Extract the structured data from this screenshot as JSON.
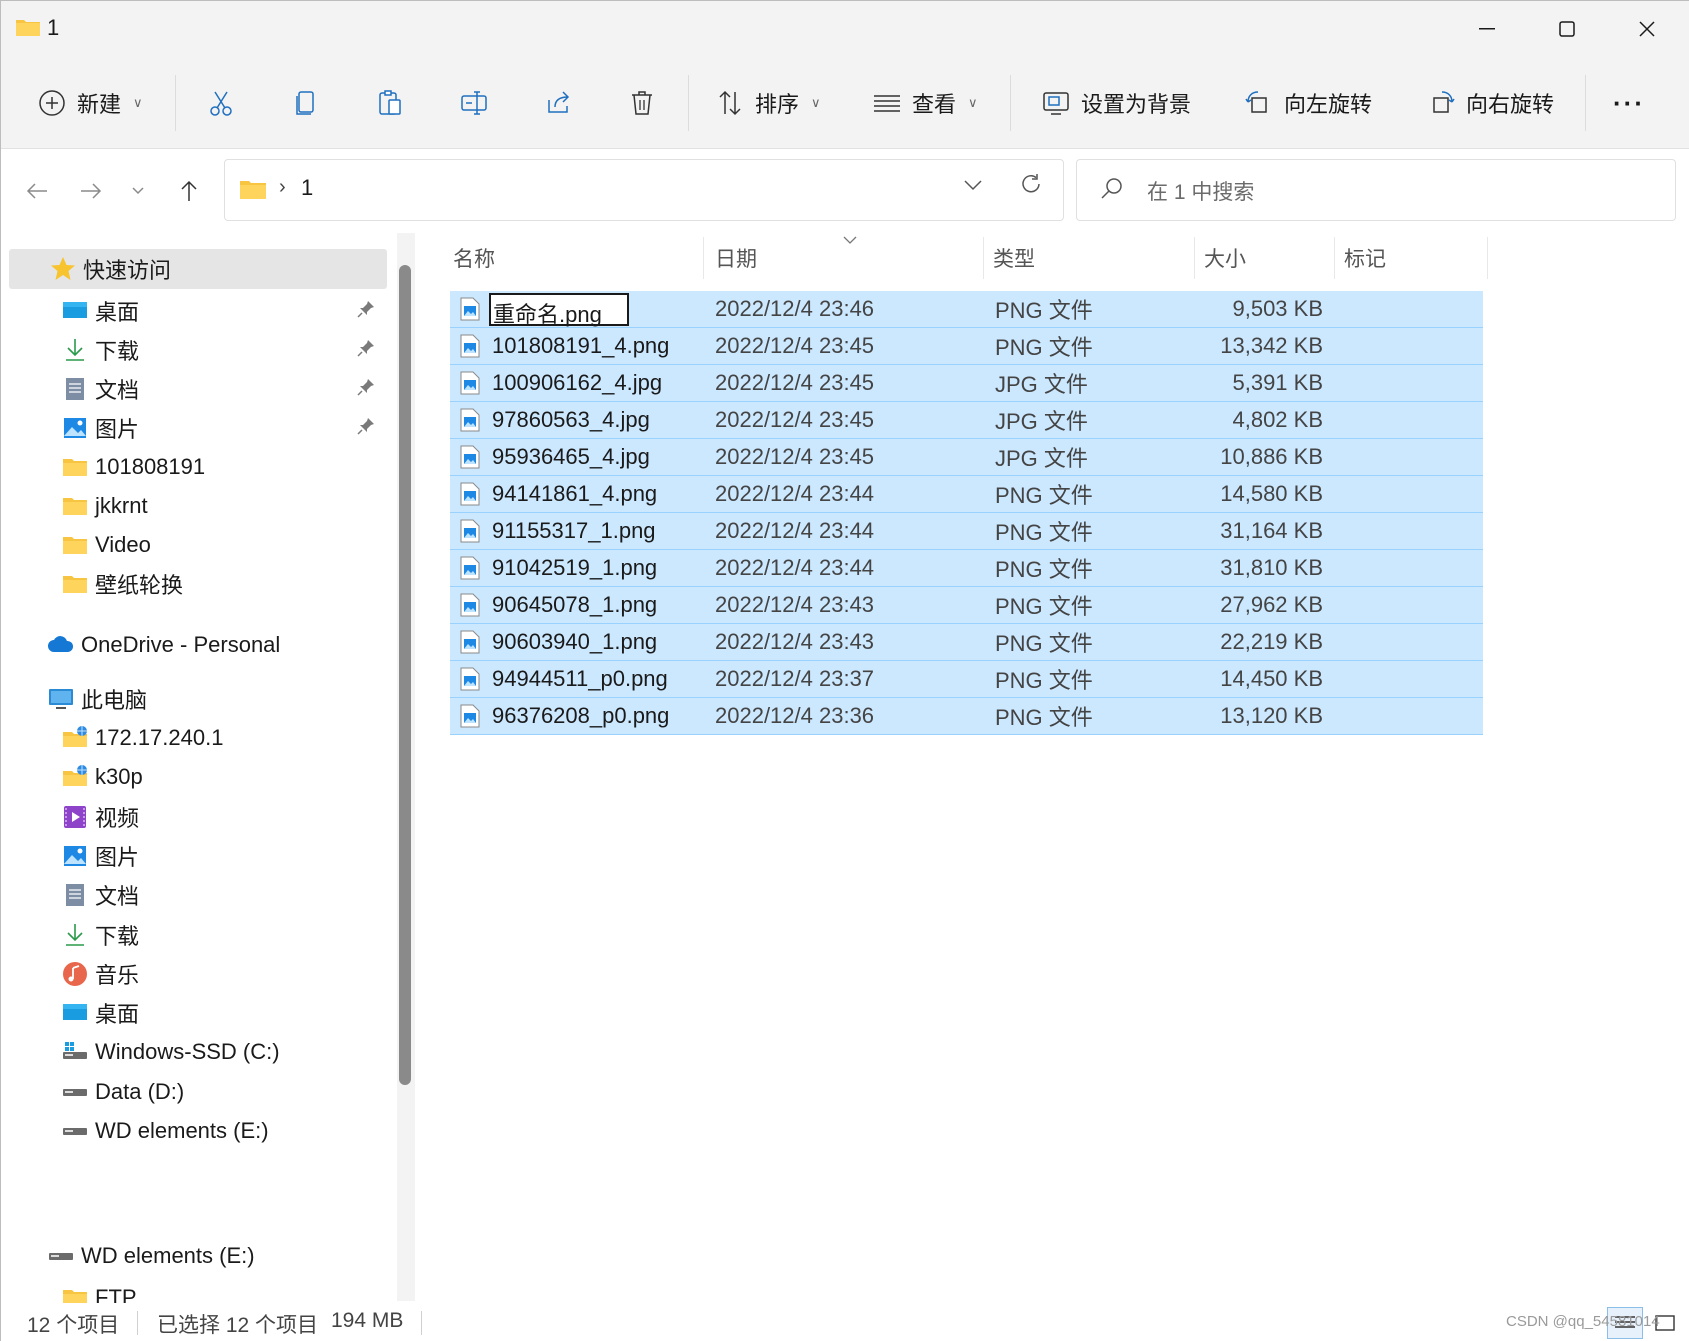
{
  "window": {
    "title": "1"
  },
  "toolbar": {
    "new_label": "新建",
    "sort_label": "排序",
    "view_label": "查看",
    "set_bg_label": "设置为背景",
    "rotate_left_label": "向左旋转",
    "rotate_right_label": "向右旋转",
    "more_label": "···"
  },
  "address": {
    "path": "1",
    "separator": "›"
  },
  "search": {
    "placeholder": "在 1 中搜索"
  },
  "sidebar": {
    "quick_access": "快速访问",
    "items": [
      {
        "label": "桌面",
        "icon": "desktop-icon",
        "pinned": true
      },
      {
        "label": "下载",
        "icon": "download-icon",
        "pinned": true
      },
      {
        "label": "文档",
        "icon": "document-icon",
        "pinned": true
      },
      {
        "label": "图片",
        "icon": "pictures-icon",
        "pinned": true
      },
      {
        "label": "101808191",
        "icon": "folder-icon",
        "pinned": false
      },
      {
        "label": "jkkrnt",
        "icon": "folder-icon",
        "pinned": false
      },
      {
        "label": "Video",
        "icon": "folder-icon",
        "pinned": false
      },
      {
        "label": "壁纸轮换",
        "icon": "folder-icon",
        "pinned": false
      }
    ],
    "onedrive": "OneDrive - Personal",
    "this_pc": "此电脑",
    "pc_items": [
      {
        "label": "172.17.240.1",
        "icon": "network-drive-icon"
      },
      {
        "label": "k30p",
        "icon": "network-drive-icon"
      },
      {
        "label": "视频",
        "icon": "video-icon"
      },
      {
        "label": "图片",
        "icon": "pictures-icon"
      },
      {
        "label": "文档",
        "icon": "document-icon"
      },
      {
        "label": "下载",
        "icon": "download-icon"
      },
      {
        "label": "音乐",
        "icon": "music-icon"
      },
      {
        "label": "桌面",
        "icon": "desktop-icon"
      },
      {
        "label": "Windows-SSD (C:)",
        "icon": "windows-drive-icon"
      },
      {
        "label": "Data (D:)",
        "icon": "drive-icon"
      },
      {
        "label": "WD elements (E:)",
        "icon": "drive-icon"
      }
    ],
    "wd_root": "WD elements (E:)",
    "ftp": "FTP"
  },
  "columns": {
    "name": "名称",
    "date": "日期",
    "type": "类型",
    "size": "大小",
    "tags": "标记"
  },
  "files": [
    {
      "name": "重命名.png",
      "date": "2022/12/4 23:46",
      "type": "PNG 文件",
      "size": "9,503 KB",
      "renaming": true
    },
    {
      "name": "101808191_4.png",
      "date": "2022/12/4 23:45",
      "type": "PNG 文件",
      "size": "13,342 KB"
    },
    {
      "name": "100906162_4.jpg",
      "date": "2022/12/4 23:45",
      "type": "JPG 文件",
      "size": "5,391 KB"
    },
    {
      "name": "97860563_4.jpg",
      "date": "2022/12/4 23:45",
      "type": "JPG 文件",
      "size": "4,802 KB"
    },
    {
      "name": "95936465_4.jpg",
      "date": "2022/12/4 23:45",
      "type": "JPG 文件",
      "size": "10,886 KB"
    },
    {
      "name": "94141861_4.png",
      "date": "2022/12/4 23:44",
      "type": "PNG 文件",
      "size": "14,580 KB"
    },
    {
      "name": "91155317_1.png",
      "date": "2022/12/4 23:44",
      "type": "PNG 文件",
      "size": "31,164 KB"
    },
    {
      "name": "91042519_1.png",
      "date": "2022/12/4 23:44",
      "type": "PNG 文件",
      "size": "31,810 KB"
    },
    {
      "name": "90645078_1.png",
      "date": "2022/12/4 23:43",
      "type": "PNG 文件",
      "size": "27,962 KB"
    },
    {
      "name": "90603940_1.png",
      "date": "2022/12/4 23:43",
      "type": "PNG 文件",
      "size": "22,219 KB"
    },
    {
      "name": "94944511_p0.png",
      "date": "2022/12/4 23:37",
      "type": "PNG 文件",
      "size": "14,450 KB"
    },
    {
      "name": "96376208_p0.png",
      "date": "2022/12/4 23:36",
      "type": "PNG 文件",
      "size": "13,120 KB"
    }
  ],
  "status": {
    "count": "12 个项目",
    "selected": "已选择 12 个项目",
    "size": "194 MB"
  },
  "watermark": "CSDN @qq_54581014",
  "colors": {
    "selection": "#cce8ff",
    "selection_border": "#99d1ff",
    "accent": "#0067c0"
  }
}
